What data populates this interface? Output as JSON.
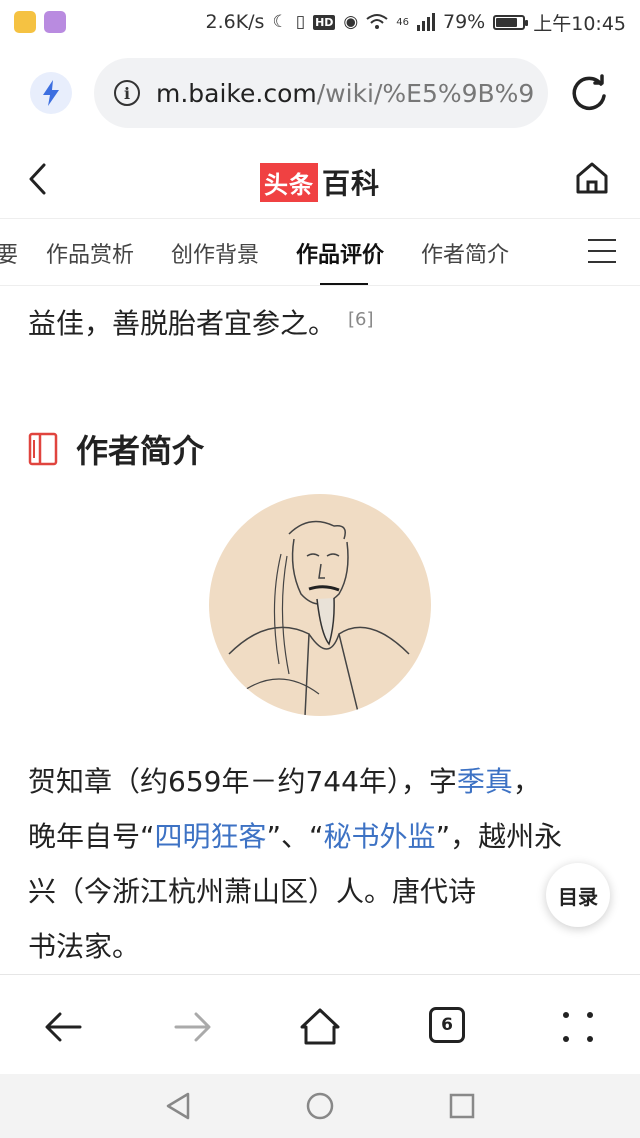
{
  "status_bar": {
    "net_speed": "2.6K/s",
    "signal_label": "46",
    "battery": "79%",
    "battery_level": 0.79,
    "time": "上午10:45",
    "icons": [
      "weibo-icon",
      "app-icon",
      "moon-icon",
      "vibrate-icon",
      "hd-icon",
      "eye-icon",
      "wifi-icon",
      "signal-icon",
      "battery-icon"
    ]
  },
  "url_bar": {
    "host": "m.baike.com",
    "path": "/wiki/%E5%9B%9"
  },
  "header": {
    "logo_part1": "头条",
    "logo_part2": "百科"
  },
  "tabs": {
    "items": [
      {
        "label": "要"
      },
      {
        "label": "作品赏析"
      },
      {
        "label": "创作背景"
      },
      {
        "label": "作品评价"
      },
      {
        "label": "作者简介"
      }
    ],
    "active_index": 3
  },
  "content": {
    "top_paragraph": "益佳，善脱胎者宜参之。",
    "top_ref": "[6]",
    "section_title": "作者简介",
    "bio": {
      "l1a": "贺知章（约659年－约744年），字",
      "l1_link": "季真",
      "l1b": "，",
      "l2a": "晚年自号“",
      "l2_link1": "四明狂客",
      "l2b": "”、“",
      "l2_link2": "秘书外监",
      "l2c": "”，越州永",
      "l3": "兴（今浙江杭州萧山区）人。唐代诗",
      "l4": "书法家。"
    },
    "toc_label": "目录"
  },
  "bottom_nav": {
    "tab_count": "6"
  },
  "colors": {
    "link": "#3d72c4",
    "logo_red": "#f04142",
    "bolt_blue": "#3d6fe0"
  }
}
